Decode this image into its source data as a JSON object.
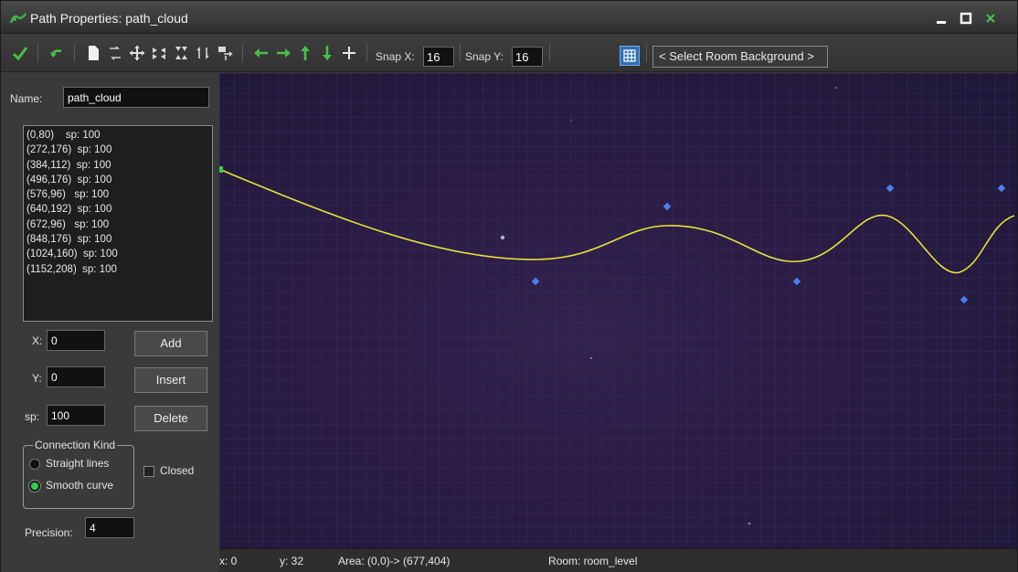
{
  "window": {
    "title": "Path Properties: path_cloud"
  },
  "toolbar": {
    "snap_x_label": "Snap X:",
    "snap_x_value": "16",
    "snap_y_label": "Snap Y:",
    "snap_y_value": "16",
    "background_button": "< Select Room Background >"
  },
  "panel": {
    "name_label": "Name:",
    "name_value": "path_cloud",
    "points": [
      "(0,80)    sp: 100",
      "(272,176)  sp: 100",
      "(384,112)  sp: 100",
      "(496,176)  sp: 100",
      "(576,96)   sp: 100",
      "(640,192)  sp: 100",
      "(672,96)   sp: 100",
      "(848,176)  sp: 100",
      "(1024,160)  sp: 100",
      "(1152,208)  sp: 100"
    ],
    "x_label": "X:",
    "x_value": "0",
    "y_label": "Y:",
    "y_value": "0",
    "sp_label": "sp:",
    "sp_value": "100",
    "add_button": "Add",
    "insert_button": "Insert",
    "delete_button": "Delete",
    "connection_kind_label": "Connection Kind",
    "straight_label": "Straight lines",
    "smooth_label": "Smooth curve",
    "closed_label": "Closed",
    "precision_label": "Precision:",
    "precision_value": "4"
  },
  "status": {
    "x": "x: 0",
    "y": "y: 32",
    "area": "Area: (0,0)-> (677,404)",
    "room": "Room: room_level"
  },
  "colors": {
    "path_line": "#e8e23a",
    "control_point": "#4a7ff0",
    "start_point": "#30d040",
    "canvas_background": "#241a3e",
    "grid_line": "#3a2f5c"
  }
}
